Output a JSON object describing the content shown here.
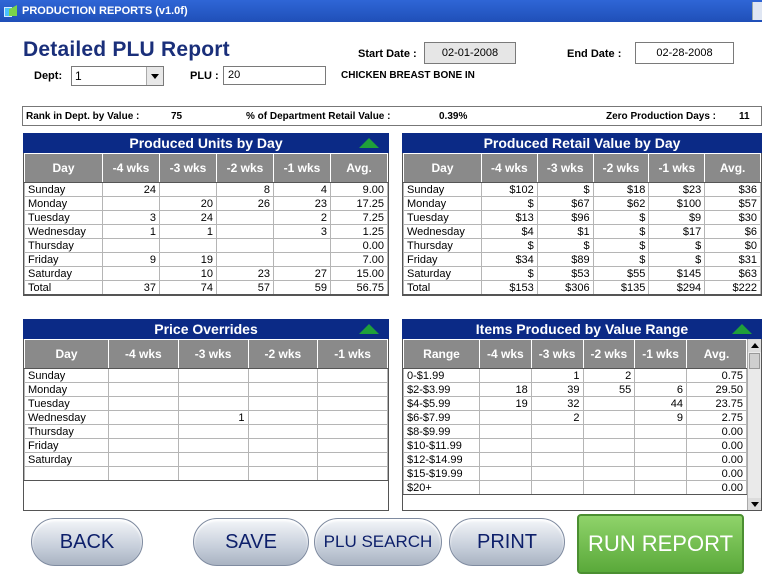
{
  "window": {
    "title": "PRODUCTION REPORTS (v1.0f)"
  },
  "header": {
    "title": "Detailed PLU Report",
    "start_label": "Start Date :",
    "start_date": "02-01-2008",
    "end_label": "End Date :",
    "end_date": "02-28-2008",
    "dept_label": "Dept:",
    "dept_value": "1",
    "plu_label": "PLU :",
    "plu_value": "20",
    "item_name": "CHICKEN BREAST BONE IN"
  },
  "summary": {
    "rank_label": "Rank in Dept. by Value :",
    "rank_value": "75",
    "pct_label": "% of Department Retail Value :",
    "pct_value": "0.39%",
    "zero_label": "Zero Production Days :",
    "zero_value": "11"
  },
  "units_panel": {
    "title": "Produced Units by Day",
    "columns": [
      "Day",
      "-4 wks",
      "-3 wks",
      "-2 wks",
      "-1 wks",
      "Avg."
    ],
    "rows": [
      [
        "Sunday",
        "24",
        "",
        "8",
        "4",
        "9.00"
      ],
      [
        "Monday",
        "",
        "20",
        "26",
        "23",
        "17.25"
      ],
      [
        "Tuesday",
        "3",
        "24",
        "",
        "2",
        "7.25"
      ],
      [
        "Wednesday",
        "1",
        "1",
        "",
        "3",
        "1.25"
      ],
      [
        "Thursday",
        "",
        "",
        "",
        "",
        "0.00"
      ],
      [
        "Friday",
        "9",
        "19",
        "",
        "",
        "7.00"
      ],
      [
        "Saturday",
        "",
        "10",
        "23",
        "27",
        "15.00"
      ],
      [
        "Total",
        "37",
        "74",
        "57",
        "59",
        "56.75"
      ]
    ]
  },
  "retail_panel": {
    "title": "Produced Retail Value by Day",
    "columns": [
      "Day",
      "-4 wks",
      "-3 wks",
      "-2 wks",
      "-1 wks",
      "Avg."
    ],
    "rows": [
      [
        "Sunday",
        "$102",
        "$",
        "$18",
        "$23",
        "$36"
      ],
      [
        "Monday",
        "$",
        "$67",
        "$62",
        "$100",
        "$57"
      ],
      [
        "Tuesday",
        "$13",
        "$96",
        "$",
        "$9",
        "$30"
      ],
      [
        "Wednesday",
        "$4",
        "$1",
        "$",
        "$17",
        "$6"
      ],
      [
        "Thursday",
        "$",
        "$",
        "$",
        "$",
        "$0"
      ],
      [
        "Friday",
        "$34",
        "$89",
        "$",
        "$",
        "$31"
      ],
      [
        "Saturday",
        "$",
        "$53",
        "$55",
        "$145",
        "$63"
      ],
      [
        "Total",
        "$153",
        "$306",
        "$135",
        "$294",
        "$222"
      ]
    ]
  },
  "overrides_panel": {
    "title": "Price Overrides",
    "columns": [
      "Day",
      "-4 wks",
      "-3 wks",
      "-2 wks",
      "-1 wks"
    ],
    "rows": [
      [
        "Sunday",
        "",
        "",
        "",
        ""
      ],
      [
        "Monday",
        "",
        "",
        "",
        ""
      ],
      [
        "Tuesday",
        "",
        "",
        "",
        ""
      ],
      [
        "Wednesday",
        "",
        "1",
        "",
        ""
      ],
      [
        "Thursday",
        "",
        "",
        "",
        ""
      ],
      [
        "Friday",
        "",
        "",
        "",
        ""
      ],
      [
        "Saturday",
        "",
        "",
        "",
        ""
      ],
      [
        "",
        "",
        "",
        "",
        ""
      ]
    ]
  },
  "range_panel": {
    "title": "Items Produced by Value Range",
    "columns": [
      "Range",
      "-4 wks",
      "-3 wks",
      "-2 wks",
      "-1 wks",
      "Avg."
    ],
    "rows": [
      [
        "0-$1.99",
        "",
        "1",
        "2",
        "",
        "0.75"
      ],
      [
        "$2-$3.99",
        "18",
        "39",
        "55",
        "6",
        "29.50"
      ],
      [
        "$4-$5.99",
        "19",
        "32",
        "",
        "44",
        "23.75"
      ],
      [
        "$6-$7.99",
        "",
        "2",
        "",
        "9",
        "2.75"
      ],
      [
        "$8-$9.99",
        "",
        "",
        "",
        "",
        "0.00"
      ],
      [
        "$10-$11.99",
        "",
        "",
        "",
        "",
        "0.00"
      ],
      [
        "$12-$14.99",
        "",
        "",
        "",
        "",
        "0.00"
      ],
      [
        "$15-$19.99",
        "",
        "",
        "",
        "",
        "0.00"
      ],
      [
        "$20+",
        "",
        "",
        "",
        "",
        "0.00"
      ]
    ]
  },
  "buttons": {
    "back": "BACK",
    "save": "SAVE",
    "plu_search": "PLU SEARCH",
    "print": "PRINT",
    "run_report": "RUN REPORT"
  }
}
